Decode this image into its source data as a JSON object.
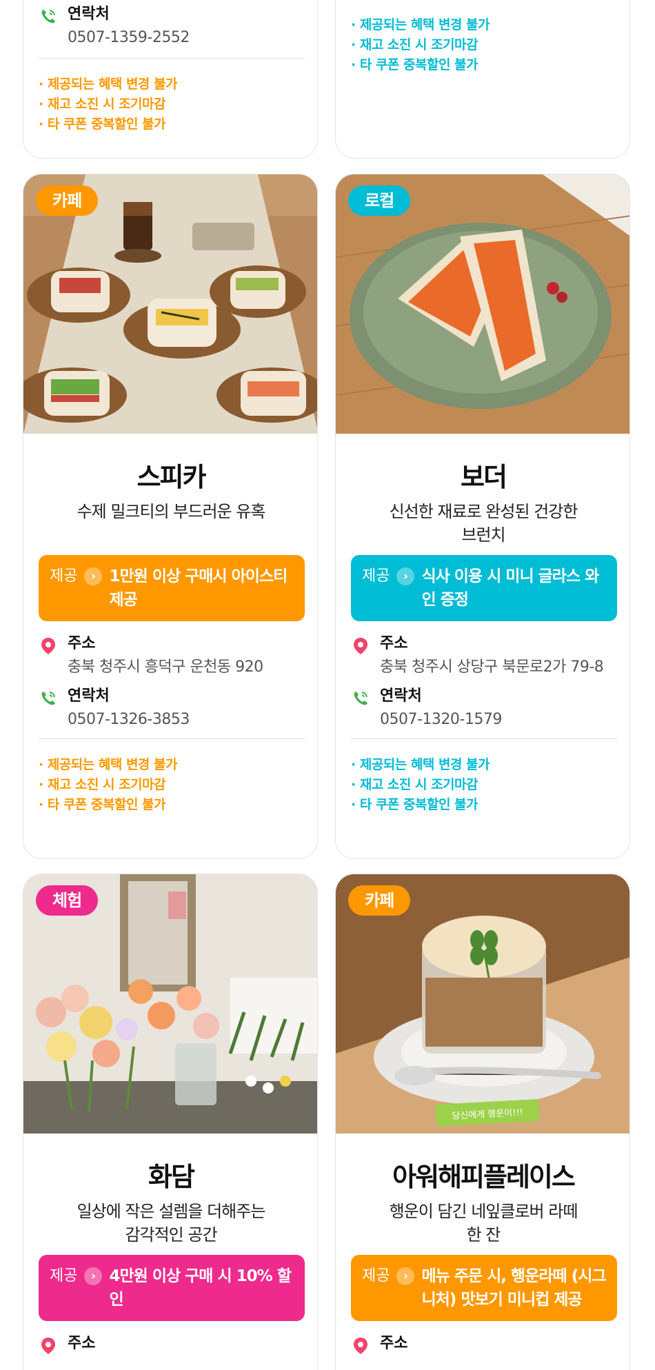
{
  "top_cards": [
    {
      "contact_label": "연락처",
      "phone": "0507-1359-2552",
      "notes": [
        "· 제공되는 혜택 변경 불가",
        "· 재고 소진 시 조기마감",
        "· 타 쿠폰 중복할인 불가"
      ],
      "accent": "#ff9800"
    },
    {
      "notes": [
        "· 제공되는 혜택 변경 불가",
        "· 재고 소진 시 조기마감",
        "· 타 쿠폰 중복할인 불가"
      ],
      "accent": "#00bcd4"
    }
  ],
  "cards": [
    {
      "tag": "카페",
      "tag_color": "#ff9800",
      "title": "스피카",
      "description": "수제 밀크티의 부드러운 유혹",
      "offer_label": "제공",
      "offer_text": "1만원 이상 구매시 아이스티 제공",
      "offer_color": "#ff9800",
      "address_label": "주소",
      "address": "충북 청주시 흥덕구 운천동 920",
      "contact_label": "연락처",
      "phone": "0507-1326-3853",
      "notes": [
        "· 제공되는 혜택 변경 불가",
        "· 재고 소진 시 조기마감",
        "· 타 쿠폰 중복할인 불가"
      ],
      "notes_color": "#ff9800",
      "photo": "sandwiches-on-wooden-plates"
    },
    {
      "tag": "로컬",
      "tag_color": "#00bcd4",
      "title": "보더",
      "description": "신선한 재료로 완성된 건강한 브런치",
      "offer_label": "제공",
      "offer_text": "식사 이용 시 미니 글라스 와인 증정",
      "offer_color": "#00bcd4",
      "address_label": "주소",
      "address": "충북 청주시 상당구 북문로2가 79-8",
      "contact_label": "연락처",
      "phone": "0507-1320-1579",
      "notes": [
        "· 제공되는 혜택 변경 불가",
        "· 재고 소진 시 조기마감",
        "· 타 쿠폰 중복할인 불가"
      ],
      "notes_color": "#00bcd4",
      "photo": "sandwich-on-green-plate"
    },
    {
      "tag": "체험",
      "tag_color": "#ee2a8c",
      "title": "화담",
      "description": "일상에 작은 설렘을 더해주는 감각적인 공간",
      "offer_label": "제공",
      "offer_text": "4만원 이상 구매 시 10% 할인",
      "offer_color": "#ee2a8c",
      "address_label": "주소",
      "photo": "flower-shop"
    },
    {
      "tag": "카페",
      "tag_color": "#ff9800",
      "title": "아워해피플레이스",
      "description": "행운이 담긴 네잎클로버 라떼 한 잔",
      "offer_label": "제공",
      "offer_text": "메뉴 주문 시, 행운라떼 (시그니처) 맛보기 미니컵 제공",
      "offer_color": "#ff9800",
      "address_label": "주소",
      "photo": "clover-latte",
      "photo_caption": "당신에게 행운이!!!"
    }
  ]
}
